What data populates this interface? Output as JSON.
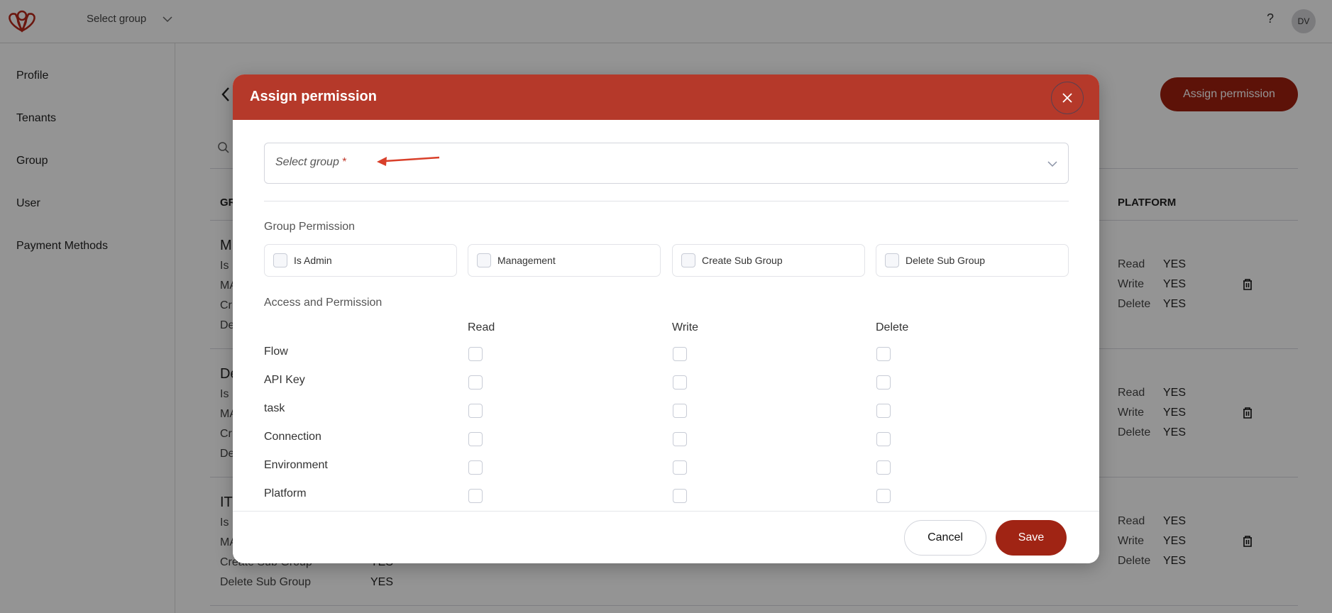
{
  "topbar": {
    "group_select_label": "Select group",
    "help_label": "?",
    "avatar_initials": "DV"
  },
  "sidebar": {
    "items": [
      {
        "label": "Profile"
      },
      {
        "label": "Tenants"
      },
      {
        "label": "Group"
      },
      {
        "label": "User"
      },
      {
        "label": "Payment Methods"
      }
    ]
  },
  "main": {
    "assign_button_label": "Assign permission",
    "columns": {
      "group_partial": "GR",
      "platform": "PLATFORM"
    },
    "groups": [
      {
        "name_partial": "M",
        "lines_partial": [
          "Is",
          "MA",
          "Cr",
          "De"
        ],
        "platform": [
          {
            "label": "Read",
            "value": "YES"
          },
          {
            "label": "Write",
            "value": "YES"
          },
          {
            "label": "Delete",
            "value": "YES"
          }
        ]
      },
      {
        "name_partial": "De",
        "lines_partial": [
          "Is",
          "MA",
          "Cr",
          "De"
        ],
        "platform": [
          {
            "label": "Read",
            "value": "YES"
          },
          {
            "label": "Write",
            "value": "YES"
          },
          {
            "label": "Delete",
            "value": "YES"
          }
        ]
      },
      {
        "name_partial": "IT",
        "lines_partial": [
          "Is",
          "MA",
          "Create Sub Group",
          "Delete Sub Group"
        ],
        "line_values": [
          "",
          "",
          "YES",
          "YES"
        ],
        "platform": [
          {
            "label": "Read",
            "value": "YES"
          },
          {
            "label": "Write",
            "value": "YES"
          },
          {
            "label": "Delete",
            "value": "YES"
          }
        ]
      }
    ]
  },
  "modal": {
    "title": "Assign permission",
    "select_group_placeholder": "Select group",
    "required_mark": "*",
    "group_permission_label": "Group Permission",
    "group_permissions": [
      {
        "label": "Is Admin",
        "checked": false
      },
      {
        "label": "Management",
        "checked": false
      },
      {
        "label": "Create Sub Group",
        "checked": false
      },
      {
        "label": "Delete Sub Group",
        "checked": false
      }
    ],
    "access_label": "Access and Permission",
    "access_columns": [
      "Read",
      "Write",
      "Delete"
    ],
    "access_rows": [
      {
        "label": "Flow",
        "read": false,
        "write": false,
        "delete": false
      },
      {
        "label": "API Key",
        "read": false,
        "write": false,
        "delete": false
      },
      {
        "label": "task",
        "read": false,
        "write": false,
        "delete": false
      },
      {
        "label": "Connection",
        "read": false,
        "write": false,
        "delete": false
      },
      {
        "label": "Environment",
        "read": false,
        "write": false,
        "delete": false
      },
      {
        "label": "Platform",
        "read": false,
        "write": false,
        "delete": false
      }
    ],
    "cancel_label": "Cancel",
    "save_label": "Save"
  },
  "colors": {
    "header_red": "#b5392a",
    "save_red": "#a02414",
    "assign_button": "#a01f0e",
    "annotation_arrow": "#d9402a"
  }
}
